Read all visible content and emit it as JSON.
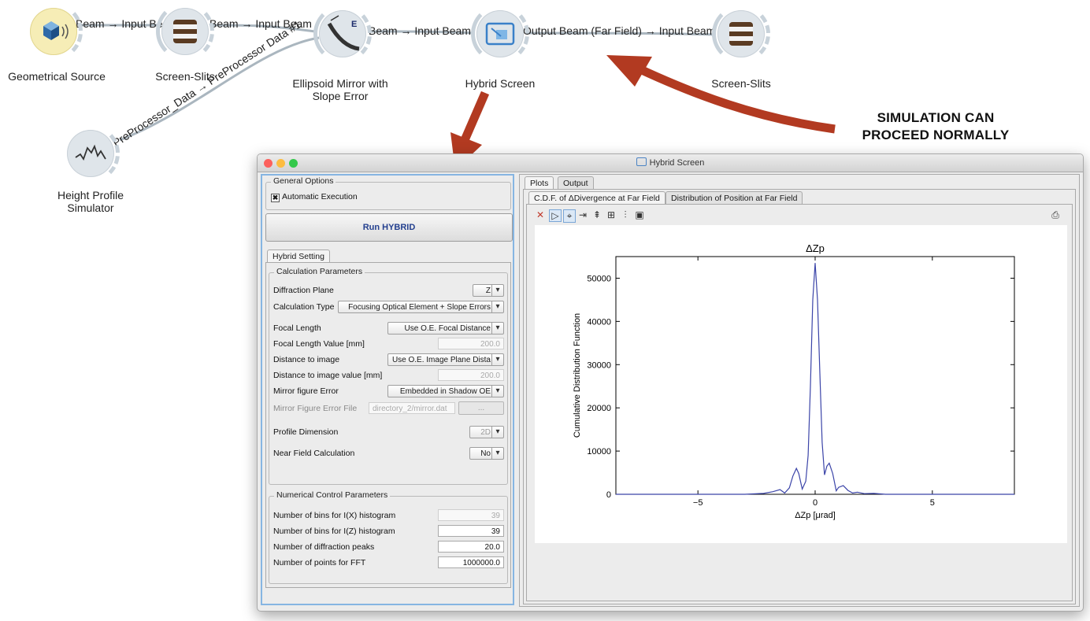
{
  "canvas": {
    "links": [
      {
        "id": "l1",
        "label": "Beam → Input Beam"
      },
      {
        "id": "l2",
        "label": "Beam → Input Beam"
      },
      {
        "id": "l3",
        "label": "Beam → Input Beam"
      },
      {
        "id": "l4",
        "label": "Output Beam (Far Field) → Input Beam"
      },
      {
        "id": "l5",
        "label": "PreProcessor_Data → PreProcessor Data #1"
      }
    ],
    "widgets": {
      "geometrical_source": "Geometrical Source",
      "screen_slits_1": "Screen-Slits",
      "ellipsoid_mirror": "Ellipsoid Mirror with\nSlope Error",
      "hybrid_screen": "Hybrid Screen",
      "screen_slits_2": "Screen-Slits",
      "height_profile": "Height Profile\nSimulator"
    },
    "annotation": "SIMULATION CAN\nPROCEED NORMALLY",
    "accent_arrow_color": "#b23a21"
  },
  "window": {
    "title": "Hybrid Screen",
    "general_options": {
      "title": "General Options",
      "automatic_execution": "Automatic Execution",
      "automatic_execution_mark": "✖"
    },
    "run_button": "Run HYBRID",
    "setting_tab": "Hybrid Setting",
    "calc_params": {
      "title": "Calculation Parameters",
      "diffraction_plane_label": "Diffraction Plane",
      "diffraction_plane_value": "Z",
      "calculation_type_label": "Calculation Type",
      "calculation_type_value": "Focusing Optical Element + Slope Errors",
      "focal_length_label": "Focal Length",
      "focal_length_value": "Use O.E. Focal Distance",
      "focal_length_value_label": "Focal Length Value [mm]",
      "focal_length_value_field": "200.0",
      "distance_to_image_label": "Distance to image",
      "distance_to_image_value": "Use O.E. Image Plane Dista",
      "distance_to_image_value_label": "Distance to image value [mm]",
      "distance_to_image_value_field": "200.0",
      "mirror_figure_error_label": "Mirror figure Error",
      "mirror_figure_error_value": "Embedded in Shadow OE",
      "mirror_figure_error_file_label": "Mirror Figure Error File",
      "mirror_figure_error_file_value": "directory_2/mirror.dat",
      "browse_button": "...",
      "profile_dimension_label": "Profile Dimension",
      "profile_dimension_value": "2D",
      "near_field_label": "Near Field Calculation",
      "near_field_value": "No"
    },
    "num_params": {
      "title": "Numerical Control Parameters",
      "bins_x_label": "Number of bins for I(X) histogram",
      "bins_x_value": "39",
      "bins_z_label": "Number of bins for I(Z) histogram",
      "bins_z_value": "39",
      "diffraction_peaks_label": "Number of diffraction peaks",
      "diffraction_peaks_value": "20.0",
      "fft_points_label": "Number of points for FFT",
      "fft_points_value": "1000000.0"
    },
    "right": {
      "tabs": [
        "Plots",
        "Output"
      ],
      "subtabs": [
        "C.D.F. of ΔDivergence at Far Field",
        "Distribution of Position at Far Field"
      ],
      "toolbar_icons": [
        "clear-icon",
        "select-icon",
        "zoom-icon",
        "x-scale-icon",
        "y-scale-icon",
        "grid-icon",
        "cursor-icon",
        "save-icon"
      ],
      "print_icon": "printer-icon"
    }
  },
  "chart_data": {
    "type": "line",
    "title": "ΔZp",
    "xlabel": "ΔZp [μrad]",
    "ylabel": "Cumulative Distribution Function",
    "xlim": [
      -8.5,
      8.5
    ],
    "ylim": [
      0,
      55000
    ],
    "xticks": [
      -5,
      0,
      5
    ],
    "yticks": [
      0,
      10000,
      20000,
      30000,
      40000,
      50000
    ],
    "series": [
      {
        "color": "#3b44a8",
        "x": [
          -8.5,
          -3,
          -2.2,
          -1.8,
          -1.5,
          -1.3,
          -1.1,
          -0.95,
          -0.8,
          -0.7,
          -0.55,
          -0.4,
          -0.3,
          -0.2,
          -0.1,
          0,
          0.1,
          0.2,
          0.3,
          0.4,
          0.5,
          0.6,
          0.75,
          0.9,
          1.0,
          1.2,
          1.4,
          1.6,
          1.8,
          2.1,
          2.5,
          3,
          8.5
        ],
        "y": [
          0,
          0,
          200,
          600,
          1100,
          300,
          1500,
          4200,
          6000,
          4800,
          1200,
          3000,
          9000,
          25000,
          45000,
          53500,
          45000,
          28000,
          12000,
          4500,
          6500,
          7200,
          4800,
          800,
          1600,
          2000,
          900,
          300,
          500,
          150,
          200,
          0,
          0
        ]
      }
    ]
  }
}
